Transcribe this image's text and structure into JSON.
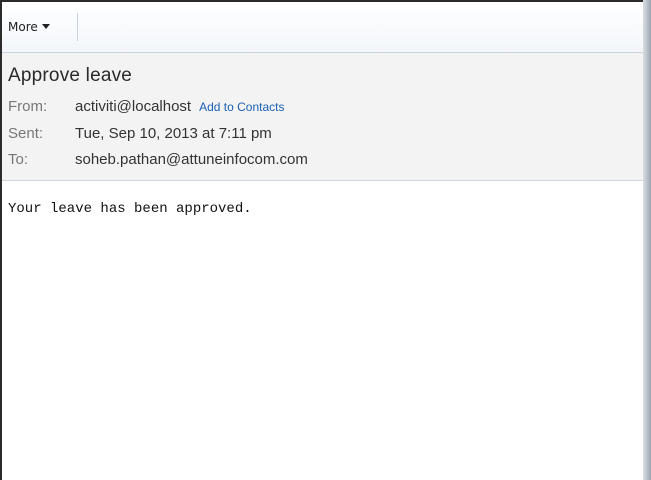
{
  "toolbar": {
    "more_label": "More"
  },
  "email": {
    "subject": "Approve leave",
    "from_label": "From:",
    "from_value": "activiti@localhost",
    "add_to_contacts": "Add to Contacts",
    "sent_label": "Sent:",
    "sent_value": "Tue, Sep 10, 2013 at 7:11 pm",
    "to_label": "To:",
    "to_value": "soheb.pathan@attuneinfocom.com",
    "body_text": "Your leave has been approved."
  },
  "colors": {
    "link": "#1a5fb4",
    "header_bg": "#f3f3f3"
  }
}
